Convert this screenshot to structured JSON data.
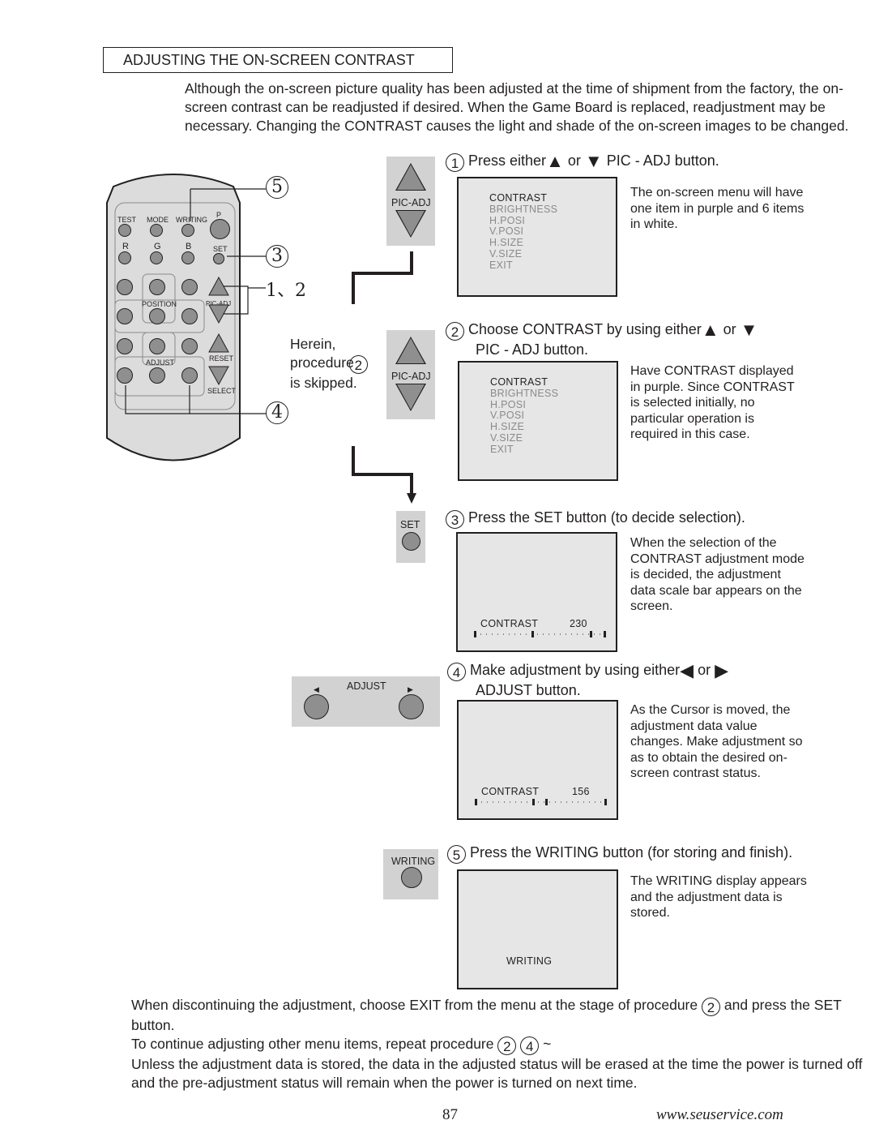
{
  "section_title": "ADJUSTING THE ON-SCREEN CONTRAST",
  "intro": "Although the on-screen picture quality has been adjusted at the time of shipment from the factory, the on-screen contrast can be readjusted if desired.  When the Game Board is replaced, readjustment may be necessary.  Changing the CONTRAST causes the light and shade of the on-screen images to be changed.",
  "remote": {
    "row1": [
      "TEST",
      "MODE",
      "WRITING",
      "P"
    ],
    "row2": [
      "R",
      "G",
      "B",
      "SET"
    ],
    "position_label": "POSITION",
    "picadj_label": "PIC-ADJ",
    "adjust_label": "ADJUST",
    "reset_label": "RESET",
    "select_label": "SELECT",
    "callouts": {
      "c5": "5",
      "c3": "3",
      "c12": "1、2",
      "c4": "4"
    }
  },
  "skip_note": {
    "line1": "Herein,",
    "line2": "procedure",
    "num": "2",
    "line3": "is skipped."
  },
  "steps": [
    {
      "num": "1",
      "head_a": "Press either",
      "head_or": "or",
      "head_b": "PIC - ADJ button.",
      "panel_label": "PIC-ADJ",
      "menu": [
        "CONTRAST",
        "BRIGHTNESS",
        "H.POSI",
        "V.POSI",
        "H.SIZE",
        "V.SIZE",
        "EXIT"
      ],
      "note": "The on-screen menu will have one item in purple and 6 items in white."
    },
    {
      "num": "2",
      "head_a": "Choose CONTRAST by using either",
      "head_or": "or",
      "head_b": "PIC - ADJ button.",
      "panel_label": "PIC-ADJ",
      "menu": [
        "CONTRAST",
        "BRIGHTNESS",
        "H.POSI",
        "V.POSI",
        "H.SIZE",
        "V.SIZE",
        "EXIT"
      ],
      "note": "Have CONTRAST displayed in purple.  Since CONTRAST is selected initially, no particular operation is required in this case."
    },
    {
      "num": "3",
      "head": "Press the SET button (to decide selection).",
      "panel_label": "SET",
      "screen_label": "CONTRAST",
      "screen_value": "230",
      "note": "When the selection of the CONTRAST adjustment mode is decided, the adjustment data scale bar appears on the screen."
    },
    {
      "num": "4",
      "head_a": "Make adjustment by using either",
      "head_or": "or",
      "head_b": "ADJUST button.",
      "panel_label": "ADJUST",
      "screen_label": "CONTRAST",
      "screen_value": "156",
      "note": "As the Cursor is moved, the adjustment data value changes.  Make adjustment so as to obtain the desired on-screen contrast status."
    },
    {
      "num": "5",
      "head": "Press the WRITING button (for storing and finish).",
      "panel_label": "WRITING",
      "screen_label": "WRITING",
      "note": "The WRITING display appears and the adjustment data is stored."
    }
  ],
  "footer": {
    "p1a": "When discontinuing the adjustment, choose EXIT from the menu at the stage of procedure",
    "p1num": "2",
    "p1b": "and press the SET button.",
    "p2a": "To continue adjusting other menu items, repeat procedure",
    "p2from": "2",
    "p2to": "4",
    "p2tilde": "~",
    "p3": "Unless the adjustment data is stored, the data in the adjusted status will be erased at the time the power is turned off and the pre-adjustment status will remain when the power is turned on next time."
  },
  "page_number": "87",
  "website": "www.seuservice.com"
}
